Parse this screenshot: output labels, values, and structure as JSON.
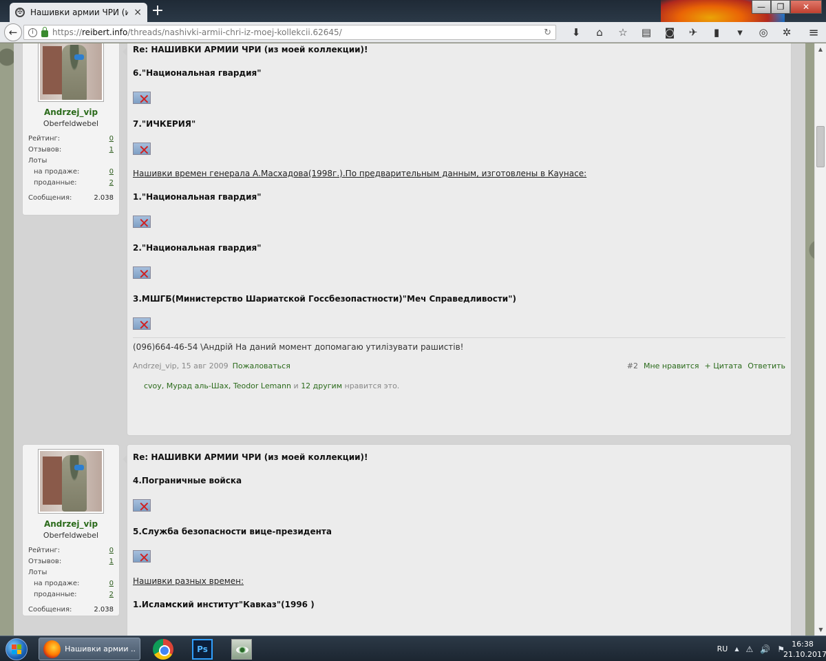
{
  "browser": {
    "tab_title": "Нашивки армии ЧРИ (из мо",
    "tab_close": "×",
    "new_tab": "+",
    "url_prefix": "https://",
    "url_domain": "reibert.info",
    "url_path": "/threads/nashivki-armii-chri-iz-moej-kollekcii.62645/",
    "window_buttons": [
      "—",
      "❐",
      "✕"
    ]
  },
  "posts": [
    {
      "user": {
        "name": "Andrzej_vip",
        "title": "Oberfeldwebel",
        "rating_label": "Рейтинг:",
        "rating": "0",
        "reviews_label": "Отзывов:",
        "reviews": "1",
        "lots_label": "Лоты",
        "on_sale_label": "на продаже:",
        "on_sale": "0",
        "sold_label": "проданные:",
        "sold": "2",
        "messages_label": "Сообщения:",
        "messages": "2.038"
      },
      "lines": [
        {
          "type": "bold",
          "text": "Re: НАШИВКИ АРМИИ ЧРИ (из моей коллекции)!"
        },
        {
          "type": "bold",
          "text": "6.\"Национальная гвардия\""
        },
        {
          "type": "img"
        },
        {
          "type": "bold",
          "text": "7.\"ИЧКЕРИЯ\""
        },
        {
          "type": "img"
        },
        {
          "type": "u",
          "text": "Нашивки времен генерала А.Масхадова(1998г.).По предварительным данным, изготовлены в Каунасе:"
        },
        {
          "type": "bold",
          "text": "1.\"Национальная гвардия\""
        },
        {
          "type": "img"
        },
        {
          "type": "bold",
          "text": "2.\"Национальная гвардия\""
        },
        {
          "type": "img"
        },
        {
          "type": "bold",
          "text": "3.МШГБ(Министерство Шариатской Госсбезопастности)\"Меч Справедливости\")"
        },
        {
          "type": "img"
        }
      ],
      "signature": "(096)664-46-54 \\Андрій На даний момент допомагаю утилізувати рашистів!",
      "footer": {
        "author_date": "Andrzej_vip, 15 авг 2009",
        "report": "Пожаловаться",
        "post_number": "#2",
        "like": "Мне нравится",
        "quote": "+ Цитата",
        "reply": "Ответить"
      },
      "likes": {
        "names": "cvoy, Мурад аль-Шах, Teodor Lemann",
        "and": " и ",
        "others": "12 другим",
        "suffix": " нравится это."
      }
    },
    {
      "user": {
        "name": "Andrzej_vip",
        "title": "Oberfeldwebel",
        "rating_label": "Рейтинг:",
        "rating": "0",
        "reviews_label": "Отзывов:",
        "reviews": "1",
        "lots_label": "Лоты",
        "on_sale_label": "на продаже:",
        "on_sale": "0",
        "sold_label": "проданные:",
        "sold": "2",
        "messages_label": "Сообщения:",
        "messages": "2.038"
      },
      "lines": [
        {
          "type": "bold",
          "text": "Re: НАШИВКИ АРМИИ ЧРИ (из моей коллекции)!"
        },
        {
          "type": "bold",
          "text": "4.Пограничные войска"
        },
        {
          "type": "img"
        },
        {
          "type": "bold",
          "text": "5.Служба безопасности вице-президента"
        },
        {
          "type": "img"
        },
        {
          "type": "u",
          "text": "Нашивки разных времен:"
        },
        {
          "type": "bold",
          "text": "1.Исламский институт\"Кавказ\"(1996 )"
        }
      ]
    }
  ],
  "taskbar": {
    "active_window": "Нашивки армии ...",
    "ps_label": "Ps",
    "lang": "RU",
    "time": "16:38",
    "date": "21.10.2017"
  }
}
